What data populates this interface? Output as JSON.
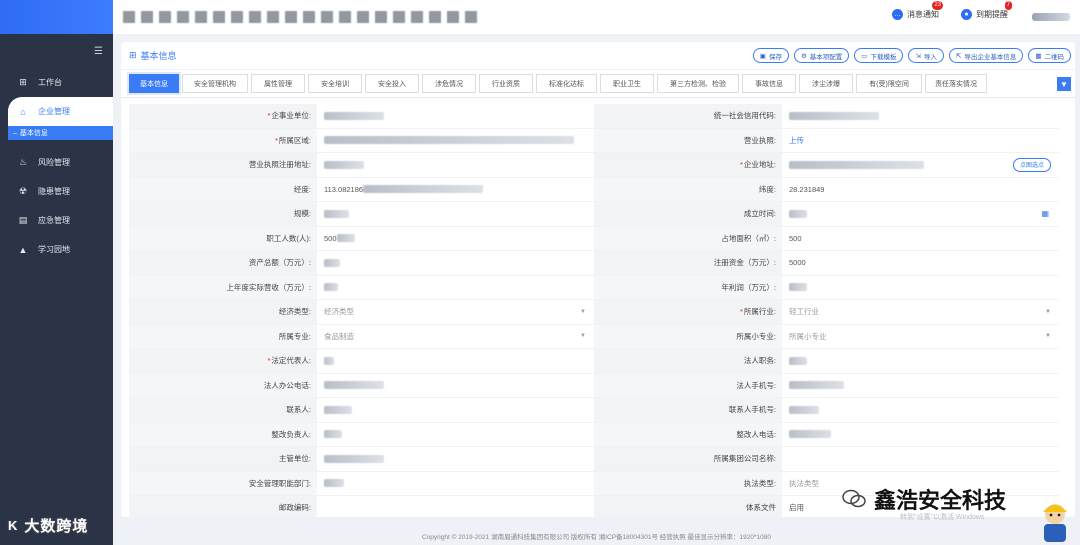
{
  "topbar": {
    "notify1": {
      "label": "消息通知",
      "count": "23"
    },
    "notify2": {
      "label": "到期提醒",
      "count": "7"
    }
  },
  "sidebar": {
    "items": [
      {
        "label": "工作台",
        "icon": "windows-icon"
      },
      {
        "label": "企业管理",
        "icon": "home-icon"
      },
      {
        "label": "风险管理",
        "icon": "fire-icon"
      },
      {
        "label": "隐患管理",
        "icon": "radiation-icon"
      },
      {
        "label": "应急管理",
        "icon": "document-icon"
      },
      {
        "label": "学习园地",
        "icon": "graduation-cap-icon"
      }
    ],
    "sub_item": "基本信息"
  },
  "card": {
    "title": "基本信息",
    "buttons": [
      "保存",
      "基本项配置",
      "下载模板",
      "导入",
      "导出企业基本信息",
      "二维码"
    ]
  },
  "tabs": [
    "基本信息",
    "安全管理机构",
    "属性管理",
    "安全培训",
    "安全投入",
    "涉危情况",
    "行业资质",
    "标准化达标",
    "职业卫生",
    "第三方检测、检验",
    "事故信息",
    "涉尘涉爆",
    "有(受)限空间",
    "责任落实情况"
  ],
  "form": {
    "rows": [
      {
        "l1": "企事业单位:",
        "r1": true,
        "v1": "",
        "l2": "统一社会信用代码:",
        "r2": false,
        "v2": ""
      },
      {
        "l1": "所属区域:",
        "r1": true,
        "v1": "",
        "l2": "营业执照:",
        "r2": false,
        "v2": "上传"
      },
      {
        "l1": "营业执照注册地址:",
        "r1": false,
        "v1": "",
        "l2": "企业地址:",
        "r2": true,
        "v2": "",
        "btn2": "点图选点"
      },
      {
        "l1": "经度:",
        "r1": false,
        "v1": "113.082186",
        "l2": "纬度:",
        "r2": false,
        "v2": "28.231849"
      },
      {
        "l1": "规模:",
        "r1": false,
        "v1": "",
        "l2": "成立时间:",
        "r2": false,
        "v2": ""
      },
      {
        "l1": "职工人数(人):",
        "r1": false,
        "v1": "500",
        "l2": "占地面积（㎡）:",
        "r2": false,
        "v2": "500"
      },
      {
        "l1": "资产总额（万元）:",
        "r1": false,
        "v1": "",
        "l2": "注册资金（万元）:",
        "r2": false,
        "v2": "5000"
      },
      {
        "l1": "上年度实际营收（万元）:",
        "r1": false,
        "v1": "",
        "l2": "年利润（万元）:",
        "r2": false,
        "v2": ""
      },
      {
        "l1": "经济类型:",
        "r1": false,
        "v1": "经济类型",
        "l2": "所属行业:",
        "r2": true,
        "v2": "轻工行业"
      },
      {
        "l1": "所属专业:",
        "r1": false,
        "v1": "食品制造",
        "l2": "所属小专业:",
        "r2": false,
        "v2": "所属小专业"
      },
      {
        "l1": "法定代表人:",
        "r1": true,
        "v1": "",
        "l2": "法人职务:",
        "r2": false,
        "v2": ""
      },
      {
        "l1": "法人办公电话:",
        "r1": false,
        "v1": "",
        "l2": "法人手机号:",
        "r2": false,
        "v2": ""
      },
      {
        "l1": "联系人:",
        "r1": false,
        "v1": "",
        "l2": "联系人手机号:",
        "r2": false,
        "v2": ""
      },
      {
        "l1": "整改负责人:",
        "r1": false,
        "v1": "",
        "l2": "整改人电话:",
        "r2": false,
        "v2": ""
      },
      {
        "l1": "主管单位:",
        "r1": false,
        "v1": "",
        "l2": "所属集团公司名称:",
        "r2": false,
        "v2": ""
      },
      {
        "l1": "安全管理职能部门:",
        "r1": false,
        "v1": "",
        "l2": "执法类型:",
        "r2": false,
        "v2": "执法类型"
      },
      {
        "l1": "邮政编码:",
        "r1": false,
        "v1": "",
        "l2": "体系文件",
        "r2": false,
        "v2": "启用"
      }
    ]
  },
  "footer": "Copyright © 2019-2021 湖南眉通科技集团有限公司 版权所有 湘ICP备18004301号 经营执照   最佳显示分辨率：1920*1080",
  "watermarks": {
    "left": "大数跨境",
    "right": "鑫浩安全科技",
    "activate": "转到\"设置\"以激活 Windows"
  }
}
